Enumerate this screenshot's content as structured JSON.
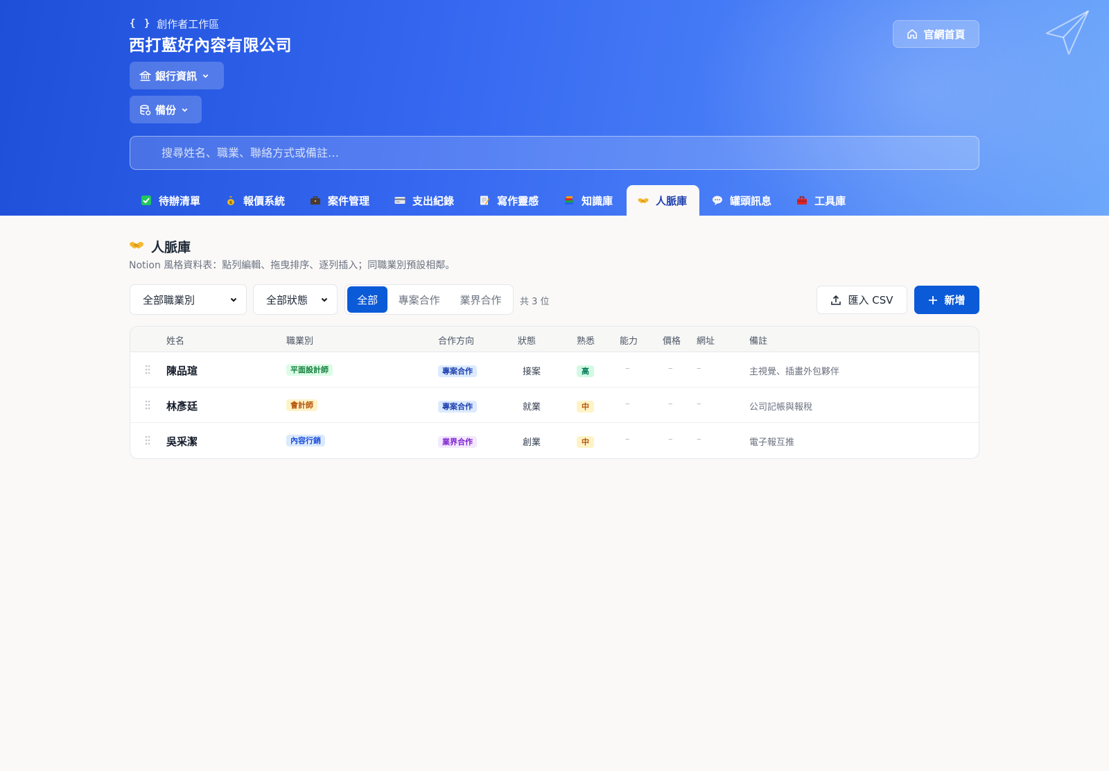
{
  "header": {
    "workspace_label": "創作者工作區",
    "company_name": "西打藍好內容有限公司",
    "home_button": "官網首頁",
    "bank_dropdown": "銀行資訊",
    "backup_dropdown": "備份",
    "search_placeholder": "搜尋姓名、職業、聯絡方式或備註…"
  },
  "tabs": [
    {
      "label": "待辦清單",
      "icon": "check-icon",
      "active": false
    },
    {
      "label": "報價系統",
      "icon": "money-bag-icon",
      "active": false
    },
    {
      "label": "案件管理",
      "icon": "briefcase-icon",
      "active": false
    },
    {
      "label": "支出紀錄",
      "icon": "credit-card-icon",
      "active": false
    },
    {
      "label": "寫作靈感",
      "icon": "memo-icon",
      "active": false
    },
    {
      "label": "知識庫",
      "icon": "books-icon",
      "active": false
    },
    {
      "label": "人脈庫",
      "icon": "handshake-icon",
      "active": true
    },
    {
      "label": "罐頭訊息",
      "icon": "speech-bubble-icon",
      "active": false
    },
    {
      "label": "工具庫",
      "icon": "toolbox-icon",
      "active": false
    }
  ],
  "section": {
    "title": "人脈庫",
    "description": "Notion 風格資料表：點列編輯、拖曳排序、逐列插入；同職業別預設相鄰。"
  },
  "filters": {
    "occupation_select": "全部職業別",
    "status_select": "全部狀態",
    "segments": [
      "全部",
      "專案合作",
      "業界合作"
    ],
    "active_segment": "全部",
    "count_text": "共 3 位",
    "import_button": "匯入 CSV",
    "add_button": "新增"
  },
  "table": {
    "columns": [
      "姓名",
      "職業別",
      "合作方向",
      "狀態",
      "熟悉",
      "能力",
      "價格",
      "網址",
      "備註"
    ],
    "rows": [
      {
        "name": "陳品瑄",
        "occupation": "平面設計師",
        "direction": "專案合作",
        "status": "接案",
        "familiarity": "高",
        "ability": "–",
        "price": "–",
        "url": "–",
        "note": "主視覺、插畫外包夥伴"
      },
      {
        "name": "林彥廷",
        "occupation": "會計師",
        "direction": "專案合作",
        "status": "就業",
        "familiarity": "中",
        "ability": "–",
        "price": "–",
        "url": "–",
        "note": "公司記帳與報稅"
      },
      {
        "name": "吳采潔",
        "occupation": "內容行銷",
        "direction": "業界合作",
        "status": "創業",
        "familiarity": "中",
        "ability": "–",
        "price": "–",
        "url": "–",
        "note": "電子報互推"
      }
    ]
  },
  "colors": {
    "primary": "#0b5ad8",
    "header_gradient_start": "#1d4fd8",
    "header_gradient_end": "#6ea8fb",
    "chip_designer_bg": "#dcfce7",
    "chip_designer_fg": "#15803d",
    "chip_accountant_bg": "#fef3c7",
    "chip_accountant_fg": "#b45309",
    "chip_marketing_bg": "#dbeafe",
    "chip_marketing_fg": "#1d4ed8",
    "chip_project_bg": "#dbeafe",
    "chip_project_fg": "#1e40af",
    "chip_industry_bg": "#f3e8ff",
    "chip_industry_fg": "#7e22ce",
    "fam_high_bg": "#d1fae5",
    "fam_high_fg": "#047857",
    "fam_mid_bg": "#fef3c7",
    "fam_mid_fg": "#b45309"
  }
}
